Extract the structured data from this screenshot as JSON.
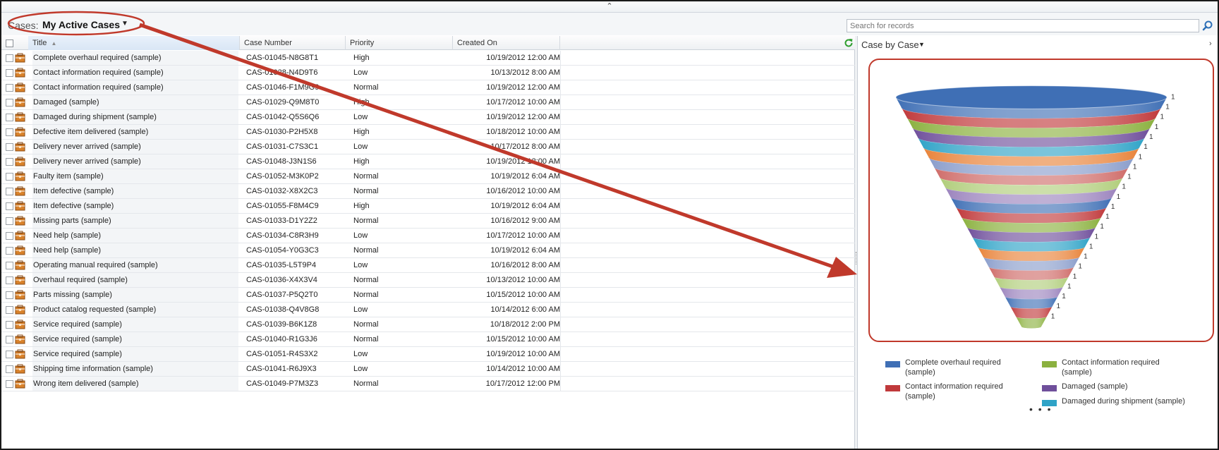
{
  "top_strip": {
    "collapse_glyph": "⌃"
  },
  "header": {
    "entity_label": "Cases:",
    "view_name": "My Active Cases",
    "view_caret": "▼",
    "search_placeholder": "Search for records"
  },
  "grid": {
    "columns": {
      "title": "Title",
      "case_number": "Case Number",
      "priority": "Priority",
      "created_on": "Created On"
    },
    "sorted_column": "Title",
    "rows": [
      {
        "title": "Complete overhaul required (sample)",
        "case_number": "CAS-01045-N8G8T1",
        "priority": "High",
        "created_on": "10/19/2012 12:00 AM"
      },
      {
        "title": "Contact information required (sample)",
        "case_number": "CAS-01028-N4D9T6",
        "priority": "Low",
        "created_on": "10/13/2012 8:00 AM"
      },
      {
        "title": "Contact information required (sample)",
        "case_number": "CAS-01046-F1M9G9",
        "priority": "Normal",
        "created_on": "10/19/2012 12:00 AM"
      },
      {
        "title": "Damaged (sample)",
        "case_number": "CAS-01029-Q9M8T0",
        "priority": "High",
        "created_on": "10/17/2012 10:00 AM"
      },
      {
        "title": "Damaged during shipment (sample)",
        "case_number": "CAS-01042-Q5S6Q6",
        "priority": "Low",
        "created_on": "10/19/2012 12:00 AM"
      },
      {
        "title": "Defective item delivered (sample)",
        "case_number": "CAS-01030-P2H5X8",
        "priority": "High",
        "created_on": "10/18/2012 10:00 AM"
      },
      {
        "title": "Delivery never arrived (sample)",
        "case_number": "CAS-01031-C7S3C1",
        "priority": "Low",
        "created_on": "10/17/2012 8:00 AM"
      },
      {
        "title": "Delivery never arrived (sample)",
        "case_number": "CAS-01048-J3N1S6",
        "priority": "High",
        "created_on": "10/19/2012 12:00 AM"
      },
      {
        "title": "Faulty item (sample)",
        "case_number": "CAS-01052-M3K0P2",
        "priority": "Normal",
        "created_on": "10/19/2012 6:04 AM"
      },
      {
        "title": "Item defective (sample)",
        "case_number": "CAS-01032-X8X2C3",
        "priority": "Normal",
        "created_on": "10/16/2012 10:00 AM"
      },
      {
        "title": "Item defective (sample)",
        "case_number": "CAS-01055-F8M4C9",
        "priority": "High",
        "created_on": "10/19/2012 6:04 AM"
      },
      {
        "title": "Missing parts (sample)",
        "case_number": "CAS-01033-D1Y2Z2",
        "priority": "Normal",
        "created_on": "10/16/2012 9:00 AM"
      },
      {
        "title": "Need help (sample)",
        "case_number": "CAS-01034-C8R3H9",
        "priority": "Low",
        "created_on": "10/17/2012 10:00 AM"
      },
      {
        "title": "Need help (sample)",
        "case_number": "CAS-01054-Y0G3C3",
        "priority": "Normal",
        "created_on": "10/19/2012 6:04 AM"
      },
      {
        "title": "Operating manual required (sample)",
        "case_number": "CAS-01035-L5T9P4",
        "priority": "Low",
        "created_on": "10/16/2012 8:00 AM"
      },
      {
        "title": "Overhaul required (sample)",
        "case_number": "CAS-01036-X4X3V4",
        "priority": "Normal",
        "created_on": "10/13/2012 10:00 AM"
      },
      {
        "title": "Parts missing (sample)",
        "case_number": "CAS-01037-P5Q2T0",
        "priority": "Normal",
        "created_on": "10/15/2012 10:00 AM"
      },
      {
        "title": "Product catalog requested (sample)",
        "case_number": "CAS-01038-Q4V8G8",
        "priority": "Low",
        "created_on": "10/14/2012 6:00 AM"
      },
      {
        "title": "Service required (sample)",
        "case_number": "CAS-01039-B6K1Z8",
        "priority": "Normal",
        "created_on": "10/18/2012 2:00 PM"
      },
      {
        "title": "Service required (sample)",
        "case_number": "CAS-01040-R1G3J6",
        "priority": "Normal",
        "created_on": "10/15/2012 10:00 AM"
      },
      {
        "title": "Service required (sample)",
        "case_number": "CAS-01051-R4S3X2",
        "priority": "Low",
        "created_on": "10/19/2012 10:00 AM"
      },
      {
        "title": "Shipping time information (sample)",
        "case_number": "CAS-01041-R6J9X3",
        "priority": "Low",
        "created_on": "10/14/2012 10:00 AM"
      },
      {
        "title": "Wrong item delivered (sample)",
        "case_number": "CAS-01049-P7M3Z3",
        "priority": "Normal",
        "created_on": "10/17/2012 12:00 PM"
      }
    ]
  },
  "chart_pane": {
    "title": "Case by Case",
    "caret": "▼",
    "expand_glyph": "›",
    "legend_more": "• • •"
  },
  "chart_data": {
    "type": "funnel",
    "series": [
      {
        "label_value": "1",
        "values": [
          1,
          1,
          1,
          1,
          1,
          1,
          1,
          1,
          1,
          1,
          1,
          1,
          1,
          1,
          1,
          1,
          1,
          1,
          1,
          1,
          1,
          1,
          1
        ]
      }
    ],
    "colors": [
      "#3f6fb5",
      "#c0393b",
      "#8bb13f",
      "#6f4f9b",
      "#2fa3c7",
      "#e8833a",
      "#8a9dcb",
      "#cf6c69",
      "#b0cd7a",
      "#9b83bd"
    ],
    "legend": [
      {
        "label": "Complete overhaul required (sample)",
        "color": "#3f6fb5"
      },
      {
        "label": "Contact information required (sample)",
        "color": "#8bb13f"
      },
      {
        "label": "Contact information required (sample)",
        "color": "#c0393b"
      },
      {
        "label": "Damaged (sample)",
        "color": "#6f4f9b"
      },
      {
        "label": "Damaged during shipment (sample)",
        "color": "#2fa3c7"
      }
    ]
  },
  "annotation": {
    "color": "#c0392b"
  }
}
